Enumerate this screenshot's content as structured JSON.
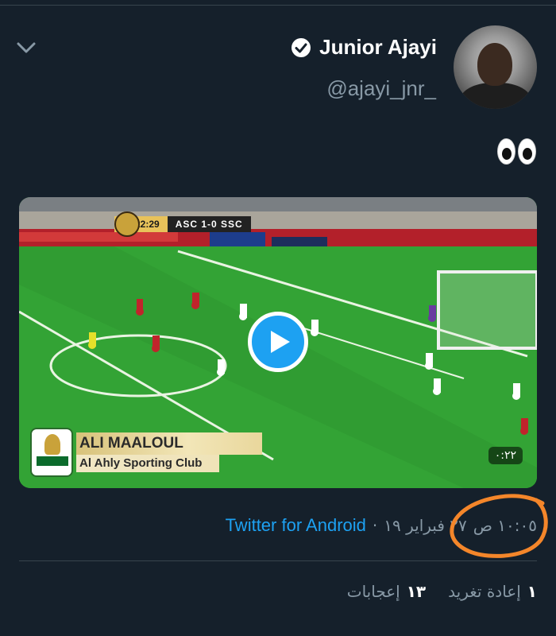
{
  "tweet": {
    "author": {
      "display_name": "Junior Ajayi",
      "handle": "@ajayi_jnr_",
      "verified": true
    },
    "text_emoji": "eyes",
    "media": {
      "scorebug": {
        "time": "22:29",
        "score": "ASC 1-0 SSC"
      },
      "caption": {
        "player": "ALI MAALOUL",
        "club": "Al Ahly Sporting Club"
      },
      "duration": "٠:٢٢"
    },
    "meta": {
      "time": "١٠:٠٥ ص",
      "date": "٢٧ فبراير ١٩",
      "separator": "·",
      "source": "Twitter for Android"
    },
    "stats": {
      "retweets_count": "١",
      "retweets_label": "إعادة تغريد",
      "likes_count": "١٣",
      "likes_label": "إعجابات"
    }
  },
  "colors": {
    "background": "#15202b",
    "accent": "#1da1f2",
    "secondary_text": "#8899a6",
    "annotation_circle": "#f4862a"
  },
  "icons": [
    "chevron-down-icon",
    "verified-badge-icon",
    "play-icon"
  ]
}
